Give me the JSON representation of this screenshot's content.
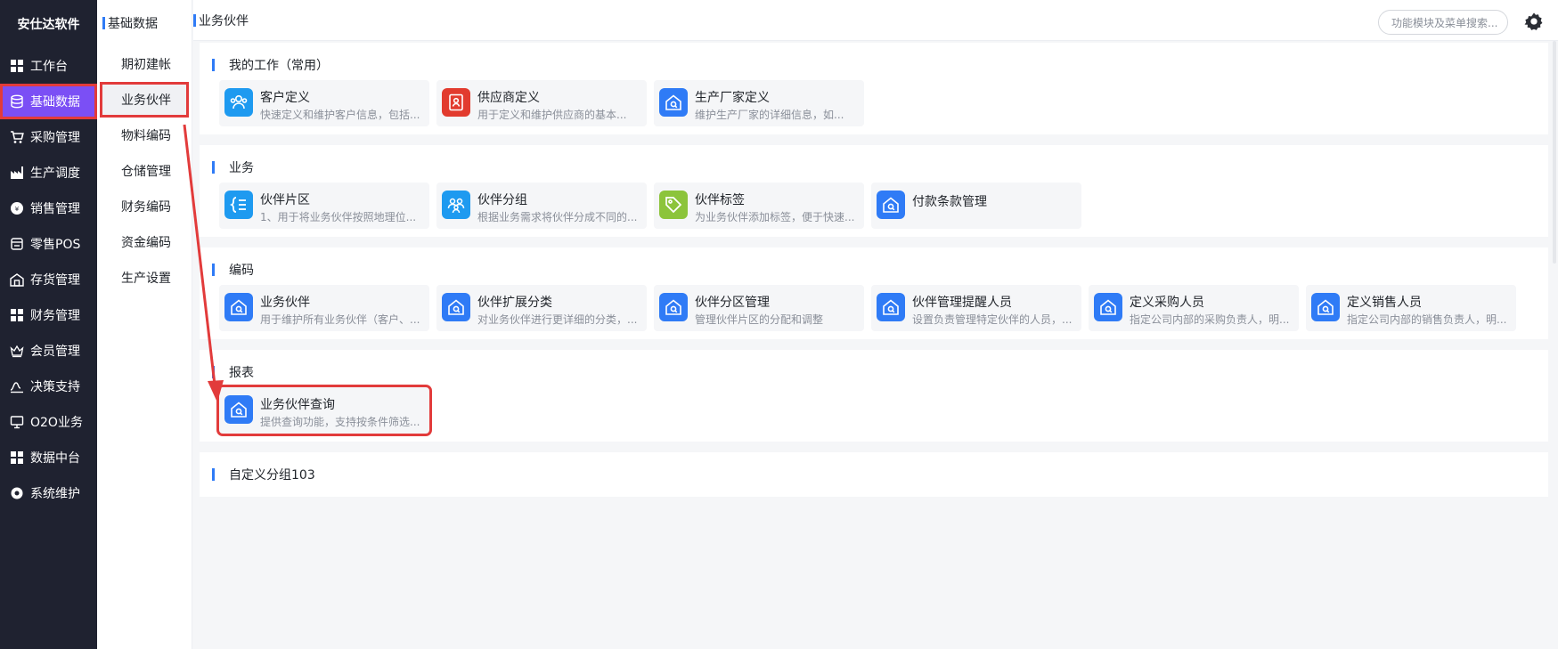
{
  "brand": "安仕达软件",
  "nav": [
    {
      "label": "工作台",
      "icon": "grid-icon"
    },
    {
      "label": "基础数据",
      "icon": "database-icon",
      "active": true
    },
    {
      "label": "采购管理",
      "icon": "cart-icon"
    },
    {
      "label": "生产调度",
      "icon": "factory-icon"
    },
    {
      "label": "销售管理",
      "icon": "sales-icon"
    },
    {
      "label": "零售POS",
      "icon": "pos-icon"
    },
    {
      "label": "存货管理",
      "icon": "warehouse-icon"
    },
    {
      "label": "财务管理",
      "icon": "grid-icon"
    },
    {
      "label": "会员管理",
      "icon": "crown-icon"
    },
    {
      "label": "决策支持",
      "icon": "decision-icon"
    },
    {
      "label": "O2O业务",
      "icon": "monitor-icon"
    },
    {
      "label": "数据中台",
      "icon": "grid-icon"
    },
    {
      "label": "系统维护",
      "icon": "gear-icon"
    }
  ],
  "submenu": {
    "title": "基础数据",
    "items": [
      "期初建帐",
      "业务伙伴",
      "物料编码",
      "仓储管理",
      "财务编码",
      "资金编码",
      "生产设置"
    ],
    "active_index": 1
  },
  "header": {
    "title": "业务伙伴",
    "search_placeholder": "功能模块及菜单搜索..."
  },
  "sections": [
    {
      "title": "我的工作（常用）",
      "cards": [
        {
          "title": "客户定义",
          "desc": "快速定义和维护客户信息，包括...",
          "icon": "users-icon",
          "color": "#1e9af0"
        },
        {
          "title": "供应商定义",
          "desc": "用于定义和维护供应商的基本...",
          "icon": "id-card-icon",
          "color": "#e23b2e"
        },
        {
          "title": "生产厂家定义",
          "desc": "维护生产厂家的详细信息，如...",
          "icon": "home-search-icon",
          "color": "#2f7bf6"
        }
      ]
    },
    {
      "title": "业务",
      "cards": [
        {
          "title": "伙伴片区",
          "desc": "1、用于将业务伙伴按照地理位...",
          "icon": "list-icon",
          "color": "#1e9af0"
        },
        {
          "title": "伙伴分组",
          "desc": "根据业务需求将伙伴分成不同的...",
          "icon": "group-icon",
          "color": "#1e9af0"
        },
        {
          "title": "伙伴标签",
          "desc": "为业务伙伴添加标签，便于快速...",
          "icon": "tag-icon",
          "color": "#8cc43b"
        },
        {
          "title": "付款条款管理",
          "desc": "",
          "icon": "home-search-icon",
          "color": "#2f7bf6"
        }
      ]
    },
    {
      "title": "编码",
      "cards": [
        {
          "title": "业务伙伴",
          "desc": "用于维护所有业务伙伴（客户、...",
          "icon": "home-search-icon",
          "color": "#2f7bf6"
        },
        {
          "title": "伙伴扩展分类",
          "desc": "对业务伙伴进行更详细的分类，...",
          "icon": "home-search-icon",
          "color": "#2f7bf6"
        },
        {
          "title": "伙伴分区管理",
          "desc": "管理伙伴片区的分配和调整",
          "icon": "home-search-icon",
          "color": "#2f7bf6"
        },
        {
          "title": "伙伴管理提醒人员",
          "desc": "设置负责管理特定伙伴的人员，...",
          "icon": "home-search-icon",
          "color": "#2f7bf6"
        },
        {
          "title": "定义采购人员",
          "desc": "指定公司内部的采购负责人，明...",
          "icon": "home-search-icon",
          "color": "#2f7bf6"
        },
        {
          "title": "定义销售人员",
          "desc": "指定公司内部的销售负责人，明...",
          "icon": "home-search-icon",
          "color": "#2f7bf6"
        }
      ]
    },
    {
      "title": "报表",
      "cards": [
        {
          "title": "业务伙伴查询",
          "desc": "提供查询功能，支持按条件筛选...",
          "icon": "home-search-icon",
          "color": "#2f7bf6"
        }
      ]
    },
    {
      "title": "自定义分组103",
      "cards": []
    }
  ]
}
